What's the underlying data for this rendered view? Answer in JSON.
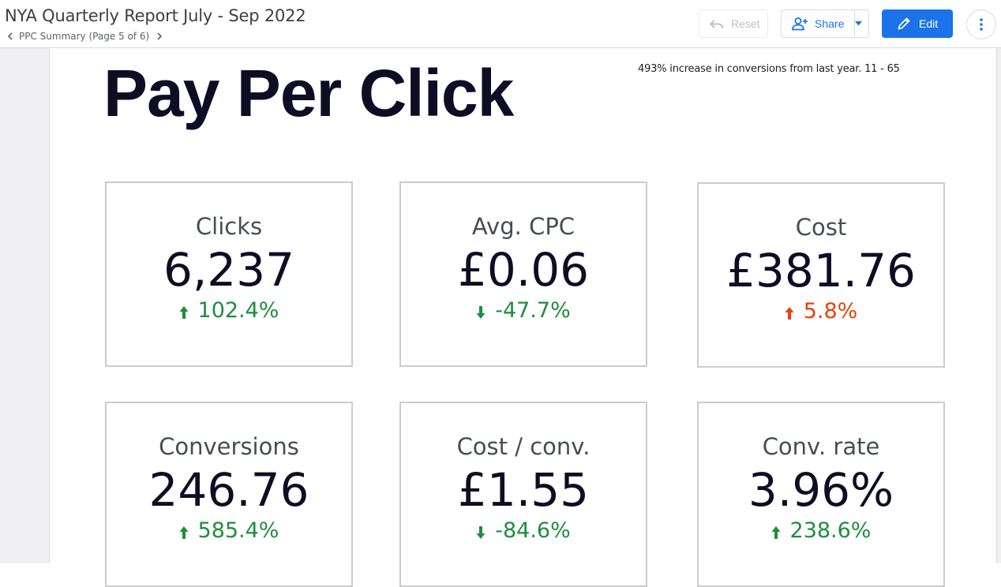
{
  "header": {
    "title": "NYA Quarterly Report July - Sep 2022",
    "page_label": "PPC Summary (Page 5 of 6)",
    "reset_label": "Reset",
    "share_label": "Share",
    "edit_label": "Edit"
  },
  "page": {
    "heading": "Pay Per Click",
    "note": "493% increase in conversions from last year. 11 - 65"
  },
  "scorecards": [
    {
      "label": "Clicks",
      "value": "6,237",
      "change": "102.4%",
      "direction": "up",
      "color": "#1e8e3e"
    },
    {
      "label": "Avg. CPC",
      "value": "£0.06",
      "change": "-47.7%",
      "direction": "down",
      "color": "#1e8e3e"
    },
    {
      "label": "Cost",
      "value": "£381.76",
      "change": "5.8%",
      "direction": "up",
      "color": "#e8420e"
    },
    {
      "label": "Conversions",
      "value": "246.76",
      "change": "585.4%",
      "direction": "up",
      "color": "#1e8e3e"
    },
    {
      "label": "Cost / conv.",
      "value": "£1.55",
      "change": "-84.6%",
      "direction": "down",
      "color": "#1e8e3e"
    },
    {
      "label": "Conv. rate",
      "value": "3.96%",
      "change": "238.6%",
      "direction": "up",
      "color": "#1e8e3e"
    }
  ],
  "icons": {
    "prev": "chevron-left-icon",
    "next": "chevron-right-icon",
    "reset": "undo-icon",
    "share": "add-person-icon",
    "edit": "pencil-icon",
    "more": "more-vert-icon"
  },
  "colors": {
    "accent": "#1a73e8",
    "positive": "#1e8e3e",
    "negative": "#e8420e",
    "heading": "#0e0d24"
  }
}
